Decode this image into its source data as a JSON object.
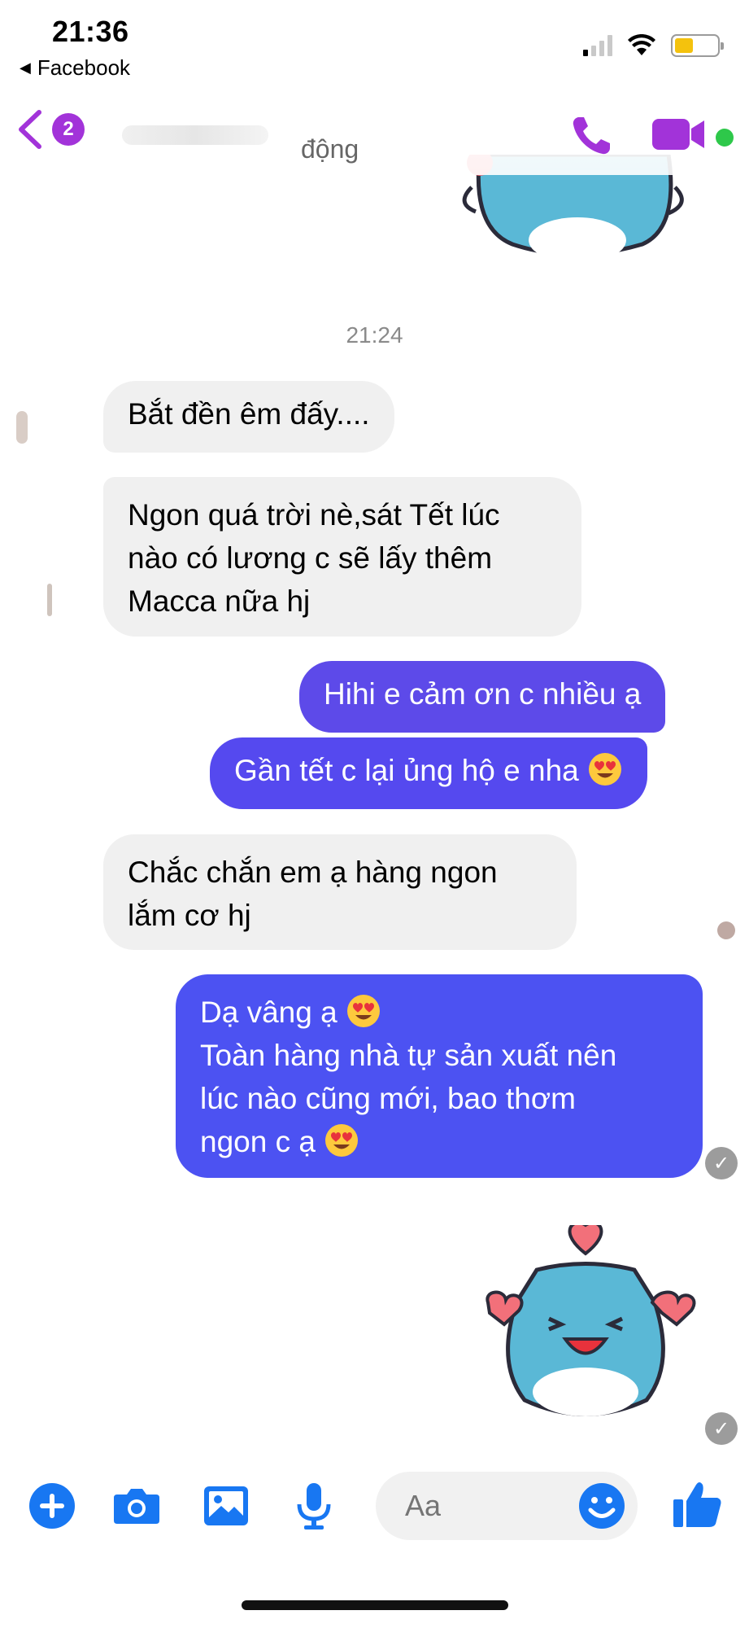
{
  "status_bar": {
    "time": "21:36",
    "back_app_label": "Facebook",
    "battery_color": "#f4c20d"
  },
  "header": {
    "unread_count": "2",
    "contact_status": "động",
    "accent_color": "#a233d9",
    "online_color": "#2ec84a",
    "icons": [
      "back-chevron-icon",
      "phone-icon",
      "video-camera-icon"
    ]
  },
  "conversation": {
    "timestamp": "21:24",
    "messages": [
      {
        "from": "contact",
        "text": "Bắt đền êm đấy...."
      },
      {
        "from": "contact",
        "lines": [
          "Ngon quá trời nè,sát Tết lúc",
          "nào có lương c sẽ lấy thêm",
          "Macca nữa hj"
        ]
      },
      {
        "from": "me",
        "text": "Hihi e cảm ơn c nhiều ạ"
      },
      {
        "from": "me",
        "text": "Gần tết c lại ủng hộ e nha",
        "emoji": "heart-eyes"
      },
      {
        "from": "contact",
        "lines": [
          "Chắc chắn em ạ hàng ngon",
          "lắm cơ hj"
        ]
      },
      {
        "from": "me",
        "lines": [
          "Dạ vâng ạ",
          "Toàn hàng nhà tự sản xuất nên",
          "lúc nào cũng mới, bao thơm",
          "ngon c ạ"
        ],
        "emoji": "heart-eyes"
      }
    ],
    "sticker": "blue-cat-hearts-sticker",
    "outgoing_color": "#5b4cf0",
    "incoming_color": "#f0f0f0"
  },
  "composer": {
    "placeholder": "Aa",
    "icon_color": "#1877f2",
    "icons": [
      "plus-icon",
      "camera-icon",
      "image-icon",
      "microphone-icon",
      "smiley-icon",
      "thumbs-up-icon"
    ]
  }
}
